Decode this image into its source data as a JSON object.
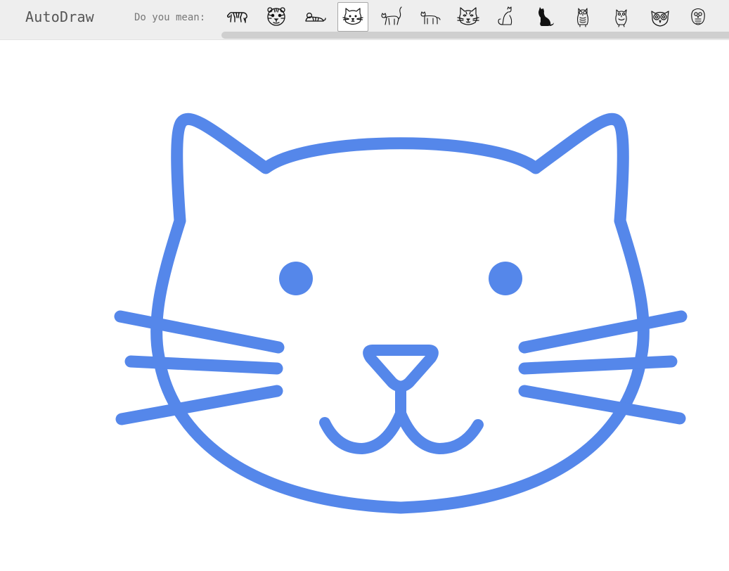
{
  "app": {
    "title": "AutoDraw"
  },
  "suggestions": {
    "prompt": "Do you mean:",
    "items": [
      {
        "icon": "tiger-walking-icon",
        "selected": false
      },
      {
        "icon": "tiger-face-icon",
        "selected": false
      },
      {
        "icon": "tiger-lying-icon",
        "selected": false
      },
      {
        "icon": "cat-face-icon",
        "selected": true
      },
      {
        "icon": "cat-walking-outline-icon",
        "selected": false
      },
      {
        "icon": "cat-standing-icon",
        "selected": false
      },
      {
        "icon": "cat-face-detailed-icon",
        "selected": false
      },
      {
        "icon": "cat-sitting-icon",
        "selected": false
      },
      {
        "icon": "cat-silhouette-icon",
        "selected": false
      },
      {
        "icon": "owl-standing-icon",
        "selected": false
      },
      {
        "icon": "owl-outline-icon",
        "selected": false
      },
      {
        "icon": "owl-face-icon",
        "selected": false
      },
      {
        "icon": "owl-small-icon",
        "selected": false
      }
    ]
  },
  "drawing": {
    "subject": "cat-face",
    "stroke_color": "#5587ea"
  },
  "colors": {
    "toolbar_bg": "#eeeeee",
    "scrollbar": "#cfcfcf",
    "selected_border": "#a8a8a8"
  }
}
